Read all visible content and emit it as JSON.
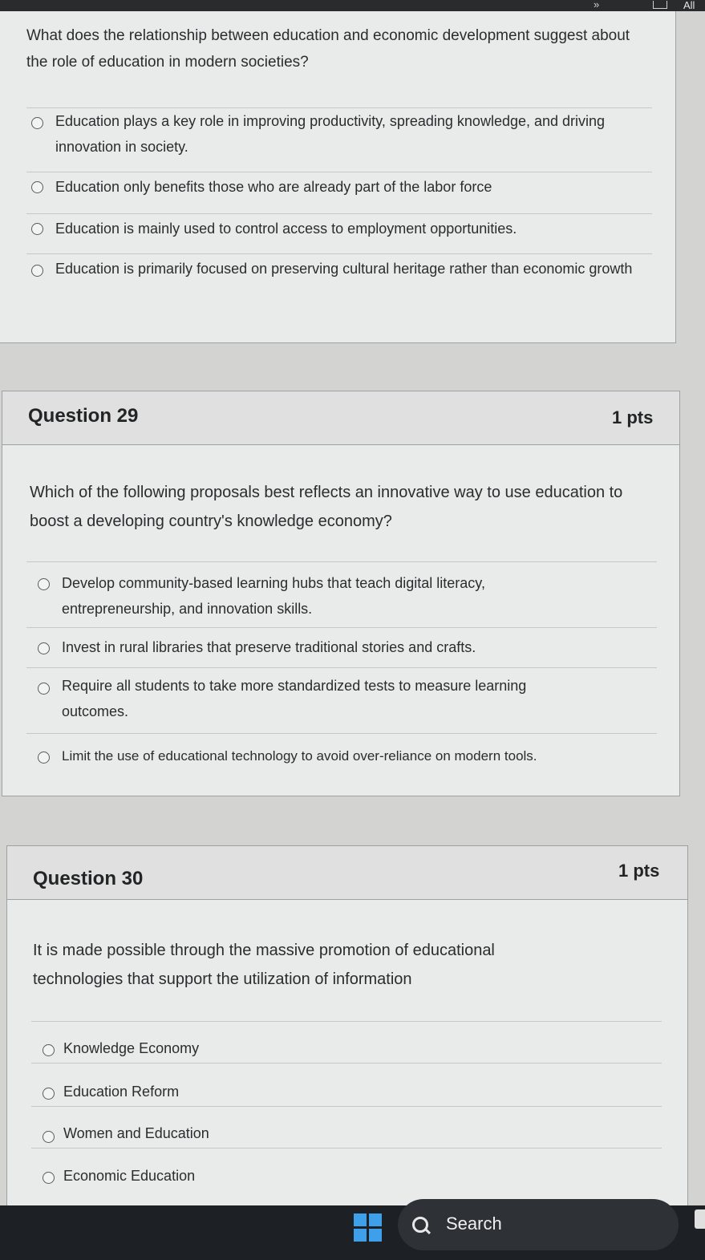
{
  "browser": {
    "overflow_icon": "»",
    "all_label": "All"
  },
  "question28": {
    "text": "What does the relationship between education and economic development suggest about the role of education in modern societies?",
    "options": [
      "Education plays a key role in improving productivity, spreading knowledge, and driving innovation in society.",
      "Education only benefits those who are already part of the labor force",
      "Education is mainly used to control access to employment opportunities.",
      "Education is primarily focused on preserving cultural heritage rather than economic growth"
    ]
  },
  "question29": {
    "title": "Question 29",
    "points": "1 pts",
    "text": "Which of the following proposals best reflects an innovative way to use education to boost a developing country's knowledge economy?",
    "options": [
      "Develop community-based learning hubs that teach digital literacy, entrepreneurship, and innovation skills.",
      "Invest in rural libraries that preserve traditional stories and crafts.",
      "Require all students to take more standardized tests to measure learning outcomes.",
      "Limit the use of educational technology to avoid over-reliance on modern tools."
    ]
  },
  "question30": {
    "title": "Question 30",
    "points": "1 pts",
    "text": "It is made possible through the massive promotion of educational technologies that support the utilization of information",
    "options": [
      "Knowledge Economy",
      "Education Reform",
      "Women and Education",
      "Economic Education"
    ]
  },
  "taskbar": {
    "search_label": "Search",
    "start_icon": "windows-logo-icon",
    "search_icon": "search-icon"
  }
}
